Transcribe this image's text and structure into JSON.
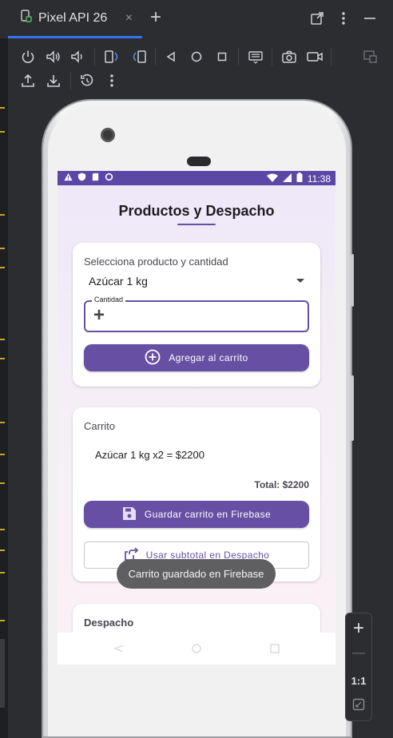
{
  "ide": {
    "tab_title": "Pixel API 26",
    "tab_close": "×",
    "new_tab": "+",
    "toolbar_icons": [
      "power-icon",
      "volume-up-icon",
      "volume-down-icon",
      "rotate-left-icon",
      "rotate-right-icon",
      "back-icon",
      "home-icon",
      "overview-icon",
      "keyboard-icon",
      "camera-icon",
      "record-icon",
      "layout-icon",
      "upload-icon",
      "download-icon",
      "reset-icon",
      "more-icon"
    ]
  },
  "status_bar": {
    "time": "11:38"
  },
  "app": {
    "title": "Productos y Despacho",
    "product_card": {
      "title": "Selecciona producto y cantidad",
      "selected_product": "Azúcar 1 kg",
      "quantity_label": "Cantidad",
      "quantity_value": "",
      "add_button": "Agregar al carrito"
    },
    "cart_card": {
      "title": "Carrito",
      "items": [
        "Azúcar 1 kg x2 = $2200"
      ],
      "total": "Total: $2200",
      "save_button": "Guardar carrito en Firebase",
      "use_subtotal_button": "Usar subtotal en Despacho"
    },
    "dispatch_card": {
      "title": "Despacho"
    },
    "toast": "Carrito guardado en Firebase"
  },
  "emulator_controls": {
    "zoom_in": "+",
    "zoom_out": "—",
    "scale_label": "1:1"
  },
  "colors": {
    "primary": "#6750a4",
    "status_bar": "#5b48a6",
    "ide_bg": "#2b2d30"
  }
}
